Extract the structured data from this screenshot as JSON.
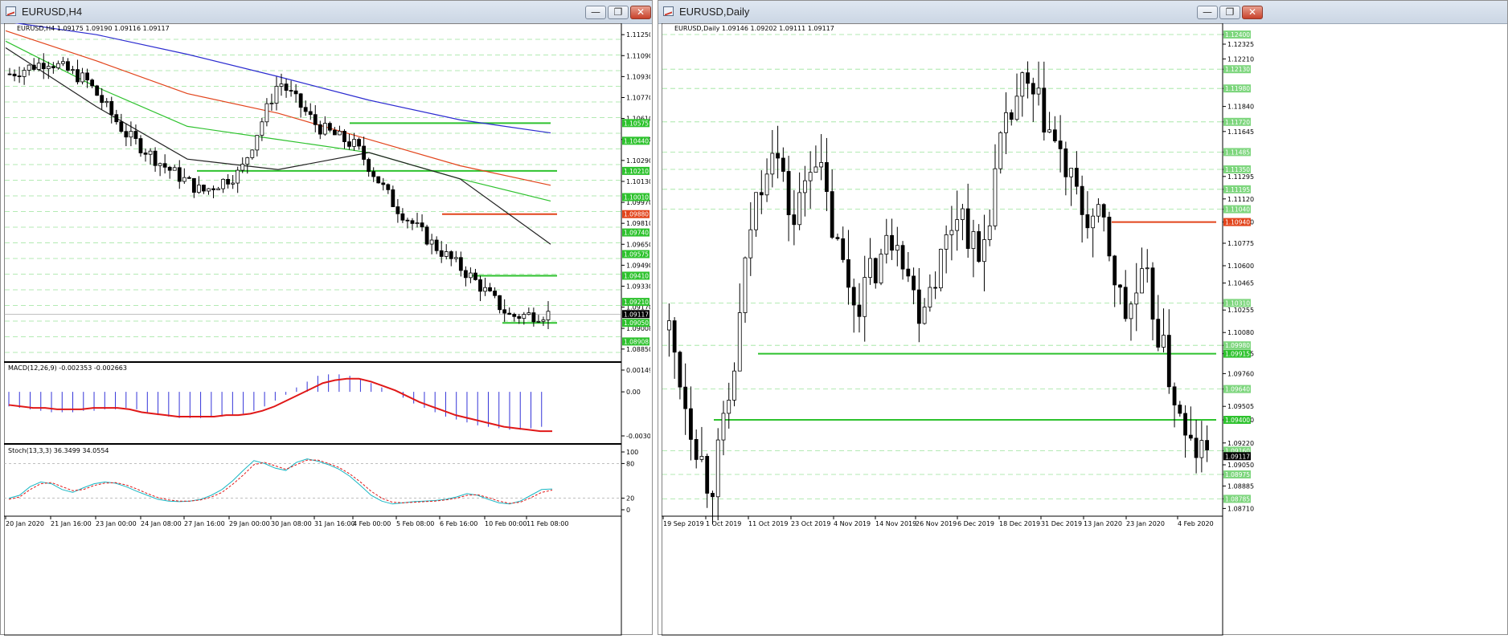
{
  "left_window": {
    "title": "EURUSD,H4",
    "buttons": {
      "minimize": "—",
      "restore": "❐",
      "close": "✕"
    },
    "main_header": "EURUSD,H4  1.09175 1.09190 1.09116 1.09117",
    "macd_header": "MACD(12,26,9) -0.002353 -0.002663",
    "stoch_header": "Stoch(13,3,3) 36.3499 34.0554"
  },
  "right_window": {
    "title": "EURUSD,Daily",
    "buttons": {
      "minimize": "—",
      "restore": "❐",
      "close": "✕"
    },
    "main_header": "EURUSD,Daily  1.09146 1.09202 1.09111 1.09117"
  },
  "chart_data": [
    {
      "id": "h4-price",
      "type": "candlestick",
      "symbol": "EURUSD",
      "timeframe": "H4",
      "ylim": [
        1.088,
        1.113
      ],
      "y_ticks": [
        "1.11250",
        "1.11090",
        "1.10930",
        "1.10770",
        "1.10610",
        "1.10450",
        "1.10290",
        "1.10130",
        "1.09970",
        "1.09810",
        "1.09650",
        "1.09490",
        "1.09330",
        "1.09170",
        "1.09008",
        "1.08850"
      ],
      "x_ticks": [
        "20 Jan 2020",
        "21 Jan 16:00",
        "23 Jan 00:00",
        "24 Jan 08:00",
        "27 Jan 16:00",
        "29 Jan 00:00",
        "30 Jan 08:00",
        "31 Jan 16:00",
        "4 Feb 00:00",
        "5 Feb 08:00",
        "6 Feb 16:00",
        "10 Feb 00:00",
        "11 Feb 08:00"
      ],
      "horizontal_levels": [
        {
          "price": 1.10575,
          "color": "#2ec22e",
          "tag": "1.10575"
        },
        {
          "price": 1.1044,
          "color": "#2ec22e",
          "tag": "1.10440"
        },
        {
          "price": 1.1021,
          "color": "#2ec22e",
          "tag": "1.10210"
        },
        {
          "price": 1.1001,
          "color": "#2ec22e",
          "tag": "1.10010"
        },
        {
          "price": 1.0988,
          "color": "#e2441b",
          "tag": "1.09880"
        },
        {
          "price": 1.0974,
          "color": "#2ec22e",
          "tag": "1.09740"
        },
        {
          "price": 1.09575,
          "color": "#2ec22e",
          "tag": "1.09575"
        },
        {
          "price": 1.0941,
          "color": "#2ec22e",
          "tag": "1.09410"
        },
        {
          "price": 1.0921,
          "color": "#2ec22e",
          "tag": "1.09210"
        },
        {
          "price": 1.0905,
          "color": "#2ec22e",
          "tag": "1.09050"
        },
        {
          "price": 1.08908,
          "color": "#2ec22e",
          "tag": "1.08908"
        }
      ],
      "current_price": "1.09117",
      "moving_averages": [
        {
          "color": "#2b2bd0",
          "values": [
            1.1135,
            1.1125,
            1.111,
            1.1093,
            1.1075,
            1.106,
            1.105
          ]
        },
        {
          "color": "#e2441b",
          "values": [
            1.1128,
            1.1105,
            1.108,
            1.1065,
            1.1045,
            1.1025,
            1.101
          ]
        },
        {
          "color": "#2ec22e",
          "values": [
            1.112,
            1.1085,
            1.1055,
            1.1045,
            1.1035,
            1.1015,
            1.0998
          ]
        },
        {
          "color": "#222222",
          "values": [
            1.1115,
            1.107,
            1.103,
            1.1022,
            1.1035,
            1.1015,
            1.0965
          ]
        }
      ]
    },
    {
      "id": "h4-macd",
      "type": "bar+line",
      "title": "MACD(12,26,9) -0.002353 -0.002663",
      "y_ticks": [
        "0.001494",
        "0.00",
        "-0.003025"
      ],
      "ylim": [
        -0.003025,
        0.001494
      ],
      "histogram": [
        -0.001,
        -0.0011,
        -0.0012,
        -0.0013,
        -0.0014,
        -0.0014,
        -0.0014,
        -0.0013,
        -0.0013,
        -0.0012,
        -0.0012,
        -0.0011,
        -0.0012,
        -0.0014,
        -0.0016,
        -0.0017,
        -0.0018,
        -0.0018,
        -0.0018,
        -0.0017,
        -0.0017,
        -0.0016,
        -0.0015,
        -0.0013,
        -0.001,
        -0.0006,
        -0.0002,
        0.0003,
        0.0007,
        0.0011,
        0.0012,
        0.0012,
        0.0011,
        0.0009,
        0.0006,
        0.0003,
        0.0,
        -0.0004,
        -0.0008,
        -0.0011,
        -0.0014,
        -0.0017,
        -0.0019,
        -0.0021,
        -0.0023,
        -0.0024,
        -0.0025,
        -0.0026,
        -0.0026,
        -0.0025,
        -0.0024
      ],
      "signal": [
        -0.0009,
        -0.001,
        -0.0011,
        -0.0011,
        -0.0012,
        -0.0012,
        -0.0012,
        -0.0011,
        -0.0011,
        -0.0011,
        -0.0012,
        -0.0014,
        -0.0015,
        -0.0016,
        -0.0017,
        -0.0017,
        -0.0017,
        -0.0017,
        -0.0016,
        -0.0016,
        -0.0015,
        -0.0013,
        -0.001,
        -0.0006,
        -0.0002,
        0.0002,
        0.0006,
        0.0008,
        0.0009,
        0.0009,
        0.0007,
        0.0004,
        0.0001,
        -0.0003,
        -0.0007,
        -0.001,
        -0.0013,
        -0.0016,
        -0.0018,
        -0.002,
        -0.0022,
        -0.0024,
        -0.0025,
        -0.0026,
        -0.0027,
        -0.0027
      ]
    },
    {
      "id": "h4-stoch",
      "type": "line",
      "title": "Stoch(13,3,3) 36.3499 34.0554",
      "y_ticks": [
        "100",
        "80",
        "20",
        "0"
      ],
      "ylim": [
        0,
        100
      ],
      "main": [
        20,
        25,
        40,
        48,
        45,
        35,
        30,
        38,
        45,
        48,
        46,
        40,
        32,
        25,
        18,
        15,
        14,
        15,
        18,
        25,
        35,
        50,
        68,
        85,
        80,
        72,
        68,
        82,
        88,
        84,
        78,
        70,
        58,
        42,
        25,
        15,
        10,
        12,
        14,
        15,
        16,
        18,
        22,
        28,
        25,
        18,
        12,
        10,
        15,
        25,
        35,
        36
      ],
      "signal": [
        18,
        22,
        35,
        45,
        47,
        40,
        33,
        35,
        42,
        46,
        47,
        43,
        36,
        28,
        21,
        17,
        15,
        15,
        17,
        22,
        30,
        44,
        60,
        78,
        82,
        76,
        70,
        78,
        86,
        86,
        80,
        73,
        62,
        48,
        32,
        20,
        13,
        12,
        13,
        14,
        15,
        17,
        20,
        25,
        26,
        21,
        15,
        11,
        13,
        21,
        30,
        34
      ]
    },
    {
      "id": "daily-price",
      "type": "candlestick",
      "symbol": "EURUSD",
      "timeframe": "Daily",
      "ylim": [
        1.087,
        1.1245
      ],
      "y_ticks": [
        "1.12400",
        "1.12325",
        "1.12210",
        "1.12130",
        "1.11980",
        "1.11840",
        "1.11720",
        "1.11645",
        "1.11485",
        "1.11350",
        "1.11295",
        "1.11195",
        "1.11120",
        "1.11040",
        "1.10940",
        "1.10775",
        "1.10600",
        "1.10465",
        "1.10310",
        "1.10255",
        "1.10080",
        "1.09980",
        "1.09915",
        "1.09760",
        "1.09640",
        "1.09505",
        "1.09400",
        "1.09220",
        "1.09160",
        "1.09050",
        "1.08975",
        "1.08885",
        "1.08785",
        "1.08710"
      ],
      "x_ticks": [
        "19 Sep 2019",
        "1 Oct 2019",
        "11 Oct 2019",
        "23 Oct 2019",
        "4 Nov 2019",
        "14 Nov 2019",
        "26 Nov 2019",
        "6 Dec 2019",
        "18 Dec 2019",
        "31 Dec 2019",
        "13 Jan 2020",
        "23 Jan 2020",
        "4 Feb 2020"
      ],
      "horizontal_levels": [
        {
          "price": 1.1094,
          "color": "#e2441b",
          "tag": "1.10940"
        },
        {
          "price": 1.09915,
          "color": "#2ec22e",
          "tag": "1.09915"
        },
        {
          "price": 1.094,
          "color": "#2ec22e",
          "tag": "1.09400"
        }
      ],
      "current_price": "1.09117"
    }
  ]
}
